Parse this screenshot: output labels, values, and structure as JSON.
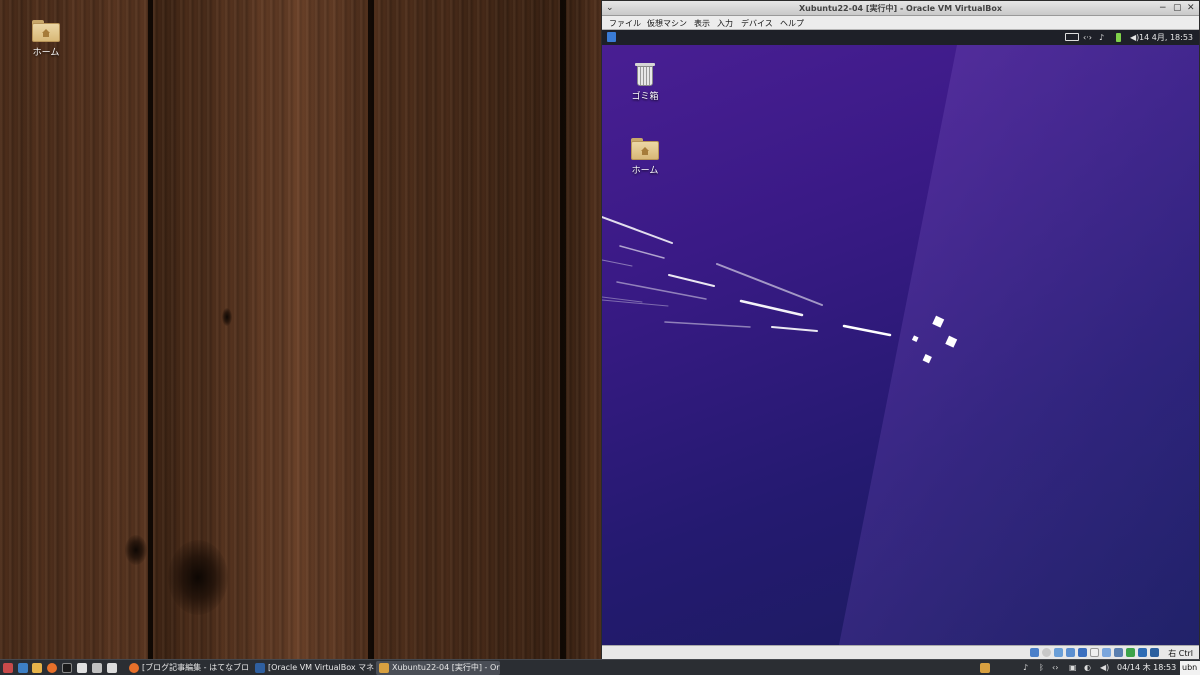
{
  "host_desktop": {
    "icons": [
      {
        "label": "ホーム",
        "icon": "home-folder-icon"
      }
    ]
  },
  "vbox": {
    "title": "Xubuntu22-04 [実行中] - Oracle VM VirtualBox",
    "title_buttons": [
      "⌄",
      "−",
      "▢",
      "✕"
    ],
    "menu": [
      "ファイル",
      "仮想マシン",
      "表示",
      "入力",
      "デバイス",
      "ヘルプ"
    ],
    "guest": {
      "panel_clock": "14 4月, 18:53",
      "panel_icons": [
        "network-icon",
        "transfer-icon",
        "bell-icon",
        "battery-icon",
        "volume-icon"
      ],
      "desktop_icons": [
        {
          "label": "ゴミ箱",
          "icon": "trash-icon"
        },
        {
          "label": "ホーム",
          "icon": "home-folder-icon"
        }
      ]
    },
    "statusbar": {
      "host_key": "右 Ctrl"
    }
  },
  "taskbar": {
    "tasks": [
      {
        "label": "[ブログ記事編集 - はてなブロ…",
        "icon": "firefox-icon",
        "active": false
      },
      {
        "label": "[Oracle VM VirtualBox マネ…",
        "icon": "virtualbox-icon",
        "active": false
      },
      {
        "label": "Xubuntu22-04 [実行中] - Ora…",
        "icon": "virtualbox-vm-icon",
        "active": true
      }
    ],
    "clock": "04/14 木 18:53",
    "workspace": "ubn"
  },
  "colors": {
    "guest_wallpaper_top": "#4a1f94",
    "guest_wallpaper_bottom": "#1a1c5c",
    "guest_panel": "#1e2028",
    "host_taskbar": "#2b2e33"
  }
}
